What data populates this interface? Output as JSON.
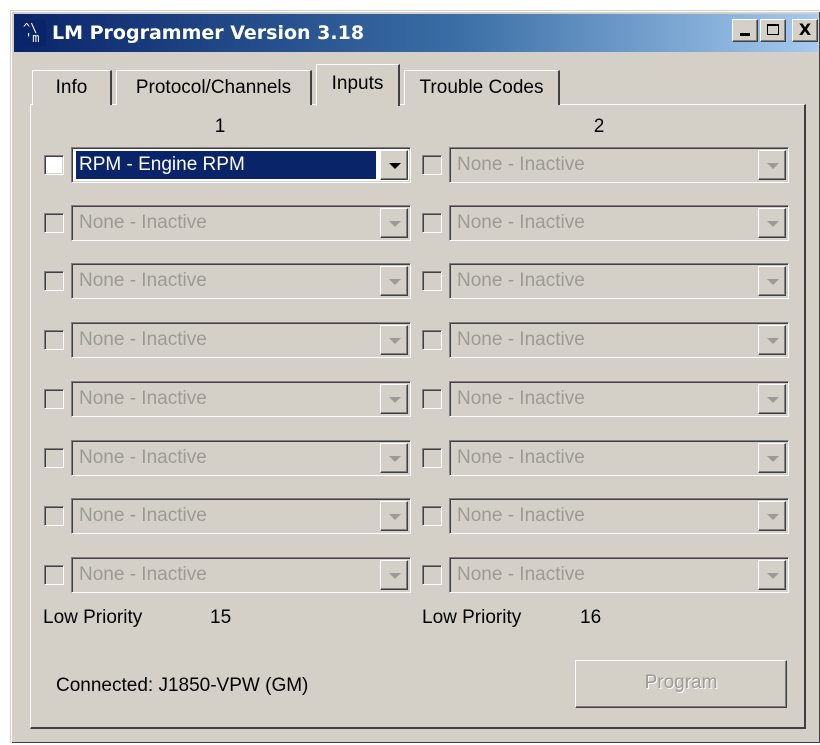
{
  "window": {
    "title": "LM Programmer Version 3.18",
    "icon_lines": [
      "^\\",
      "'m"
    ]
  },
  "titlebar_buttons": {
    "minimize": "minimize",
    "maximize": "maximize",
    "close": "X"
  },
  "tabs": [
    {
      "label": "Info",
      "active": false
    },
    {
      "label": "Protocol/Channels",
      "active": false
    },
    {
      "label": "Inputs",
      "active": true
    },
    {
      "label": "Trouble Codes",
      "active": false
    }
  ],
  "inputs": {
    "column_headers": [
      "1",
      "2"
    ],
    "columns": [
      {
        "rows": [
          {
            "checked": false,
            "enabled": true,
            "value": "RPM - Engine RPM"
          },
          {
            "checked": false,
            "enabled": false,
            "value": "None - Inactive"
          },
          {
            "checked": false,
            "enabled": false,
            "value": "None - Inactive"
          },
          {
            "checked": false,
            "enabled": false,
            "value": "None - Inactive"
          },
          {
            "checked": false,
            "enabled": false,
            "value": "None - Inactive"
          },
          {
            "checked": false,
            "enabled": false,
            "value": "None - Inactive"
          },
          {
            "checked": false,
            "enabled": false,
            "value": "None - Inactive"
          },
          {
            "checked": false,
            "enabled": false,
            "value": "None - Inactive"
          }
        ],
        "low_priority_label": "Low Priority",
        "low_priority_value": "15"
      },
      {
        "rows": [
          {
            "checked": false,
            "enabled": false,
            "value": "None - Inactive"
          },
          {
            "checked": false,
            "enabled": false,
            "value": "None - Inactive"
          },
          {
            "checked": false,
            "enabled": false,
            "value": "None - Inactive"
          },
          {
            "checked": false,
            "enabled": false,
            "value": "None - Inactive"
          },
          {
            "checked": false,
            "enabled": false,
            "value": "None - Inactive"
          },
          {
            "checked": false,
            "enabled": false,
            "value": "None - Inactive"
          },
          {
            "checked": false,
            "enabled": false,
            "value": "None - Inactive"
          },
          {
            "checked": false,
            "enabled": false,
            "value": "None - Inactive"
          }
        ],
        "low_priority_label": "Low Priority",
        "low_priority_value": "16"
      }
    ]
  },
  "status": {
    "connection": "Connected: J1850-VPW (GM)"
  },
  "actions": {
    "program_label": "Program",
    "program_enabled": false
  },
  "colors": {
    "title_gradient_start": "#0a246a",
    "title_gradient_end": "#a6caf0",
    "face": "#d4d0c8",
    "selection": "#0a246a",
    "disabled_text": "#9c9a94"
  }
}
